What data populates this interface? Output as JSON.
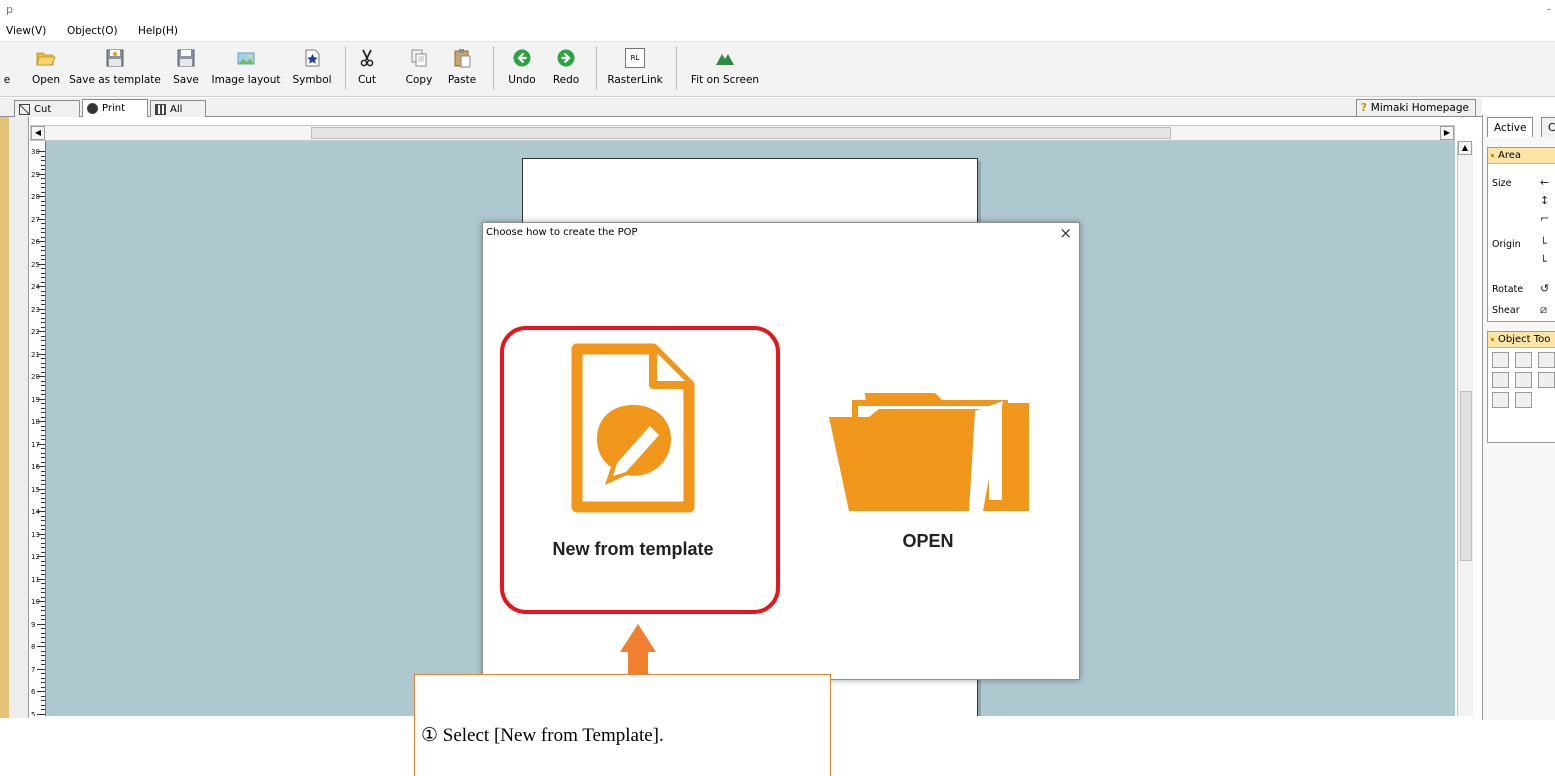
{
  "window": {
    "app_title": "p",
    "minimize_glyph": "-"
  },
  "menu": [
    {
      "label": "View(V)",
      "name": "menu-view"
    },
    {
      "label": "Object(O)",
      "name": "menu-object"
    },
    {
      "label": "Help(H)",
      "name": "menu-help"
    }
  ],
  "toolbar": {
    "truncated_label": "e",
    "open_label": "Open",
    "save_as_template_label": "Save as template",
    "save_label": "Save",
    "image_layout_label": "Image layout",
    "symbol_label": "Symbol",
    "cut_label": "Cut",
    "copy_label": "Copy",
    "paste_label": "Paste",
    "undo_label": "Undo",
    "redo_label": "Redo",
    "rasterlink_label": "RasterLink",
    "rasterlink_icon_text": "RL",
    "fit_on_screen_label": "Fit on Screen"
  },
  "tabs": {
    "cut": "Cut",
    "print": "Print",
    "all": "All",
    "homepage": "Mimaki Homepage",
    "homepage_icon": "?"
  },
  "ruler": {
    "labels": [
      "30",
      "29",
      "28",
      "27",
      "26",
      "25",
      "24",
      "23",
      "22",
      "21",
      "20",
      "19",
      "18",
      "17",
      "16",
      "15",
      "14",
      "13",
      "12",
      "11",
      "10",
      "9",
      "8",
      "7",
      "6",
      "5"
    ]
  },
  "right_panel": {
    "tab_active": "Active",
    "tab_other": "C",
    "area_header": "Area",
    "size_label": "Size",
    "origin_label": "Origin",
    "rotate_label": "Rotate",
    "shear_label": "Shear",
    "object_tools_header": "Object Too"
  },
  "dialog": {
    "title": "Choose how to create the POP",
    "close_glyph": "×",
    "new_from_template_label": "New from template",
    "open_label": "OPEN"
  },
  "annotation": {
    "callout_text": "① Select [New from Template]."
  },
  "colors": {
    "accent_orange": "#F0961B",
    "highlight_red": "#E5141D",
    "callout_orange": "#F07F2F",
    "canvas_bg": "#AEC8CF"
  },
  "icons": {
    "open": "folder-open-icon",
    "save_as_template": "save-template-icon",
    "save": "floppy-disk-icon",
    "image_layout": "image-icon",
    "symbol": "star-icon",
    "cut": "scissors-icon",
    "copy": "copy-icon",
    "paste": "paste-icon",
    "undo": "arrow-left-circle-icon",
    "redo": "arrow-right-circle-icon",
    "rasterlink": "rasterlink-icon",
    "fit_on_screen": "mountain-icon"
  }
}
